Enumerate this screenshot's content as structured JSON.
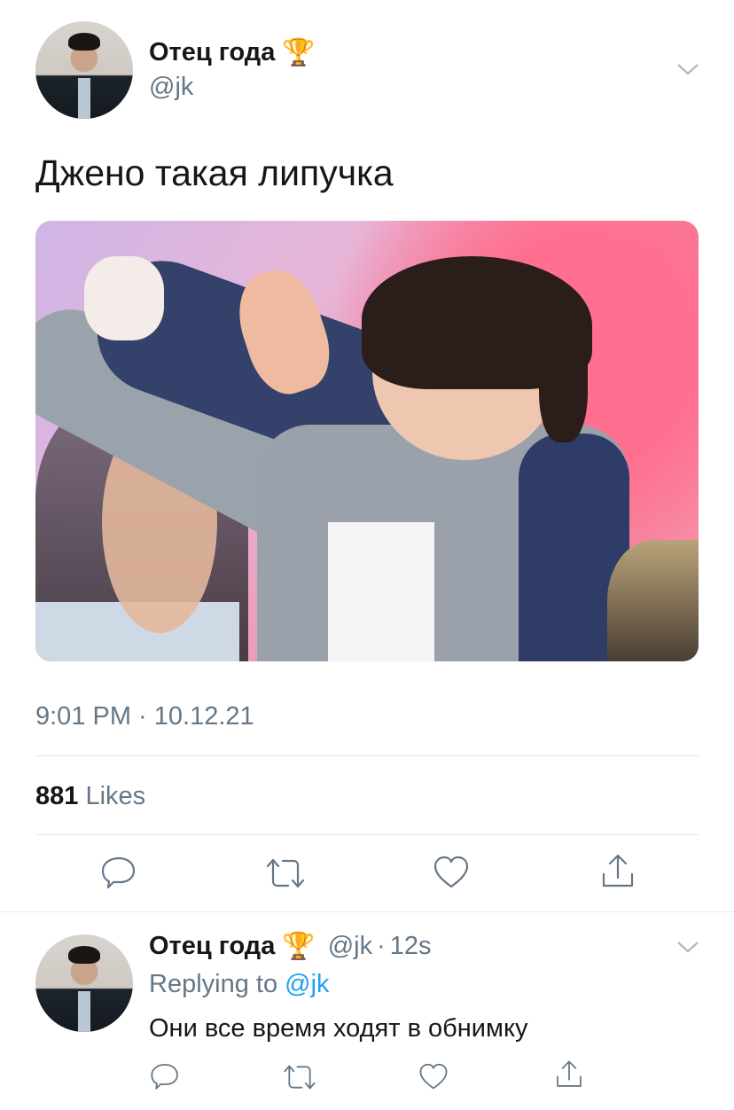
{
  "tweet": {
    "display_name": "Отец года",
    "name_emoji": "🏆",
    "handle": "@jk",
    "text": "Джено такая липучка",
    "time": "9:01 PM · 10.12.21",
    "likes_count": "881",
    "likes_label": "Likes"
  },
  "actions": {
    "reply_icon": "reply-icon",
    "retweet_icon": "retweet-icon",
    "like_icon": "heart-icon",
    "share_icon": "share-icon"
  },
  "reply": {
    "display_name": "Отец года",
    "name_emoji": "🏆",
    "handle": "@jk",
    "separator": "·",
    "age": "12s",
    "replying_prefix": "Replying to",
    "replying_to": "@jk",
    "text": "Они все время ходят в обнимку"
  },
  "colors": {
    "link": "#1da1f2",
    "secondary": "#657786",
    "divider": "#e1e8ed"
  }
}
